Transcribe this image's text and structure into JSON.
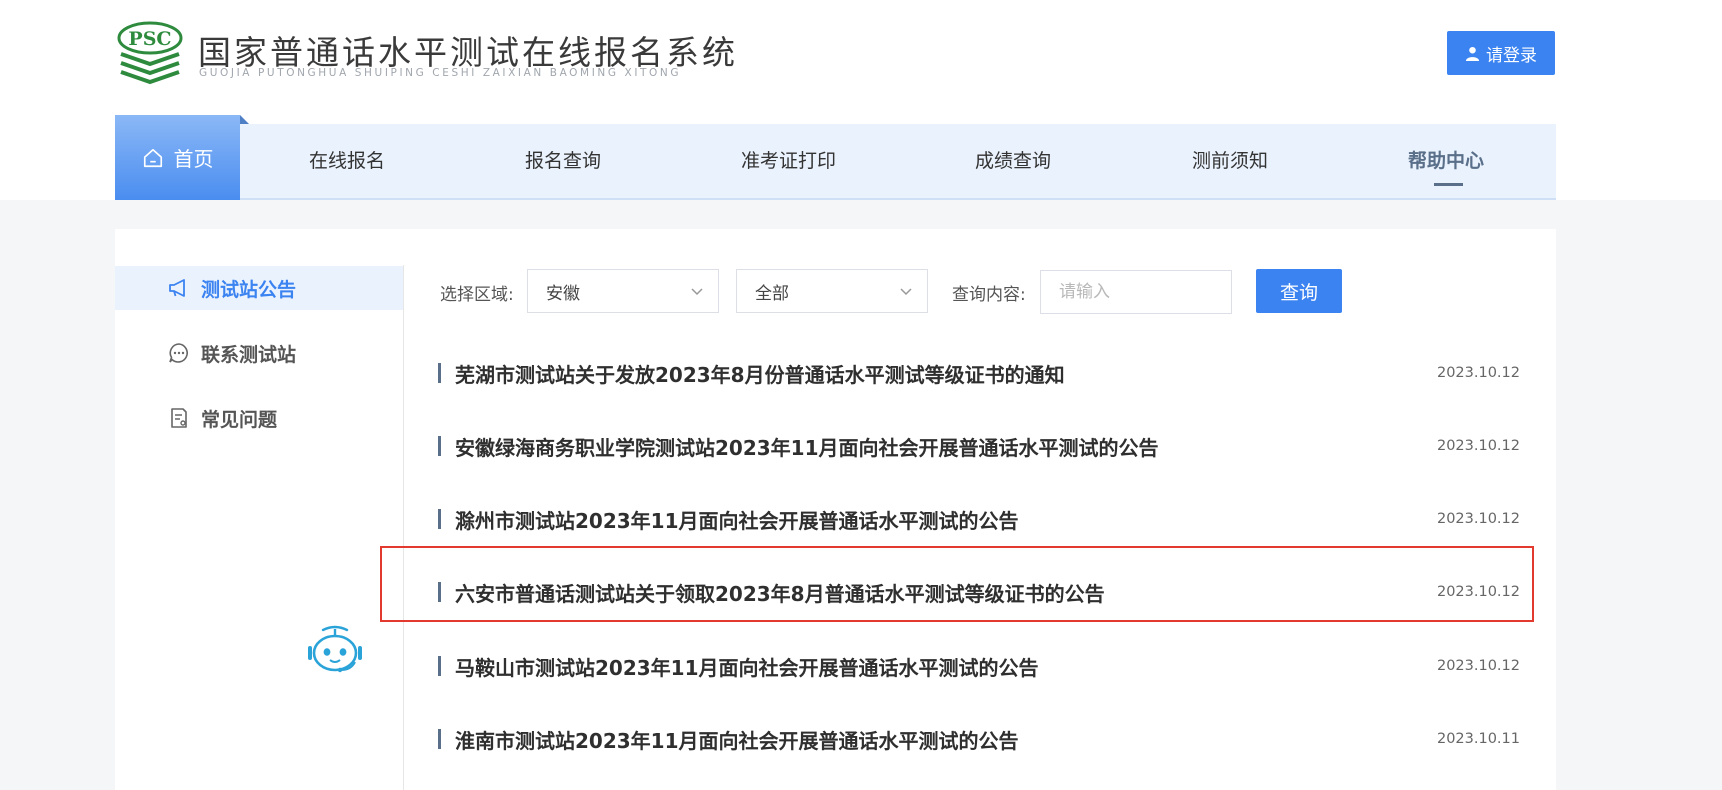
{
  "header": {
    "logo_text": "PSC",
    "title": "国家普通话水平测试在线报名系统",
    "subtitle": "GUOJIA PUTONGHUA SHUIPING CESHI ZAIXIAN BAOMING XITONG",
    "login_label": "请登录",
    "user_icon": "user-icon"
  },
  "nav": {
    "home_label": "首页",
    "home_icon": "home-icon",
    "items": [
      "在线报名",
      "报名查询",
      "准考证打印",
      "成绩查询",
      "测前须知",
      "帮助中心"
    ],
    "active_item": "帮助中心",
    "accent_color": "#3b83f0"
  },
  "sidebar": {
    "items": [
      {
        "label": "测试站公告",
        "icon": "megaphone-icon",
        "active": true
      },
      {
        "label": "联系测试站",
        "icon": "chat-bubble-icon",
        "active": false
      },
      {
        "label": "常见问题",
        "icon": "document-icon",
        "active": false
      }
    ],
    "assistant_icon": "robot-assistant-icon"
  },
  "filters": {
    "region_label": "选择区域:",
    "region_value": "安徽",
    "area_value": "全部",
    "query_label": "查询内容:",
    "query_placeholder": "请输入",
    "search_label": "查询"
  },
  "notices": [
    {
      "title": "芜湖市测试站关于发放2023年8月份普通话水平测试等级证书的通知",
      "date": "2023.10.12"
    },
    {
      "title": "安徽绿海商务职业学院测试站2023年11月面向社会开展普通话水平测试的公告",
      "date": "2023.10.12"
    },
    {
      "title": "滁州市测试站2023年11月面向社会开展普通话水平测试的公告",
      "date": "2023.10.12"
    },
    {
      "title": "六安市普通话测试站关于领取2023年8月普通话水平测试等级证书的公告",
      "date": "2023.10.12",
      "highlighted": true
    },
    {
      "title": "马鞍山市测试站2023年11月面向社会开展普通话水平测试的公告",
      "date": "2023.10.12"
    },
    {
      "title": "淮南市测试站2023年11月面向社会开展普通话水平测试的公告",
      "date": "2023.10.11"
    }
  ],
  "highlight_color": "#e23a2e"
}
